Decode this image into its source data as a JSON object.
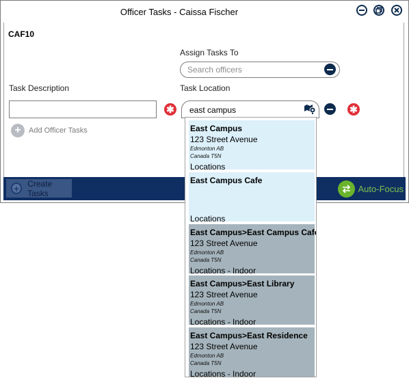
{
  "window": {
    "title": "Officer Tasks - Caissa Fischer"
  },
  "form": {
    "code": "CAF10",
    "assign_label": "Assign Tasks To",
    "search_placeholder": "Search officers",
    "task_description_label": "Task Description",
    "task_location_label": "Task Location",
    "task_description_value": "",
    "task_location_value": "east campus",
    "add_tasks_label": "Add Officer Tasks"
  },
  "footer": {
    "create_label": "Create Tasks",
    "autofocus_label": "Auto-Focus"
  },
  "dropdown": {
    "items": [
      {
        "name": "East Campus",
        "address": "123 Street Avenue",
        "city": "Edmonton AB",
        "country": "Canada T5N",
        "category": "Locations",
        "highlight": "light"
      },
      {
        "name": "East Campus Cafe",
        "address": "",
        "city": "",
        "country": "",
        "category": "Locations",
        "highlight": "light"
      },
      {
        "name": "East Campus>East Campus Cafe",
        "address": "123 Street Avenue",
        "city": "Edmonton AB",
        "country": "Canada T5N",
        "category": "Locations - Indoor",
        "highlight": "dark"
      },
      {
        "name": "East Campus>East Library",
        "address": "123 Street Avenue",
        "city": "Edmonton AB",
        "country": "Canada T5N",
        "category": "Locations - Indoor",
        "highlight": "dark"
      },
      {
        "name": "East Campus>East Residence",
        "address": "123 Street Avenue",
        "city": "Edmonton AB",
        "country": "Canada T5N",
        "category": "Locations - Indoor",
        "highlight": "dark"
      }
    ]
  },
  "icons": {
    "minimize": "minimize-icon",
    "restore": "restore-icon",
    "close": "close-icon",
    "search_collapse": "minus-circle-icon",
    "map_pin": "map-pin-icon",
    "remove": "remove-icon",
    "add": "plus-icon",
    "autofocus": "swap-arrows-icon"
  },
  "colors": {
    "navy": "#0d2b4e",
    "footer": "#0f2f63",
    "red": "#e03038",
    "green": "#6ab42d",
    "light_item": "#dcf0fa",
    "dark_item": "#a5b4bc"
  }
}
